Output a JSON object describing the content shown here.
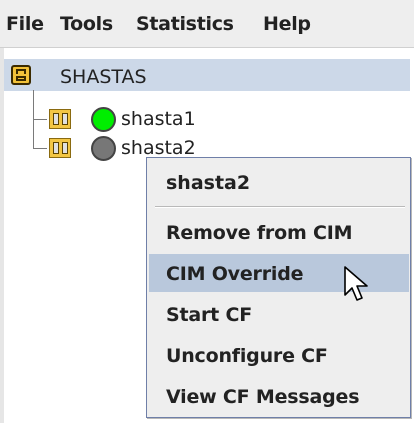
{
  "menubar": {
    "items": [
      "File",
      "Tools",
      "Statistics",
      "Help"
    ]
  },
  "tree": {
    "root": {
      "label": "SHASTAS",
      "icon": "cluster-icon"
    },
    "nodes": [
      {
        "label": "shasta1",
        "status_color": "#00ee00",
        "icon": "server-icon"
      },
      {
        "label": "shasta2",
        "status_color": "#777777",
        "icon": "server-icon"
      }
    ]
  },
  "context_menu": {
    "title": "shasta2",
    "items": [
      {
        "label": "Remove from CIM"
      },
      {
        "label": "CIM Override",
        "selected": true
      },
      {
        "label": "Start CF"
      },
      {
        "label": "Unconfigure CF"
      },
      {
        "label": "View CF Messages"
      }
    ]
  },
  "colors": {
    "root_selection": "#ccd8e8",
    "menu_selection": "#b9c8dc"
  }
}
